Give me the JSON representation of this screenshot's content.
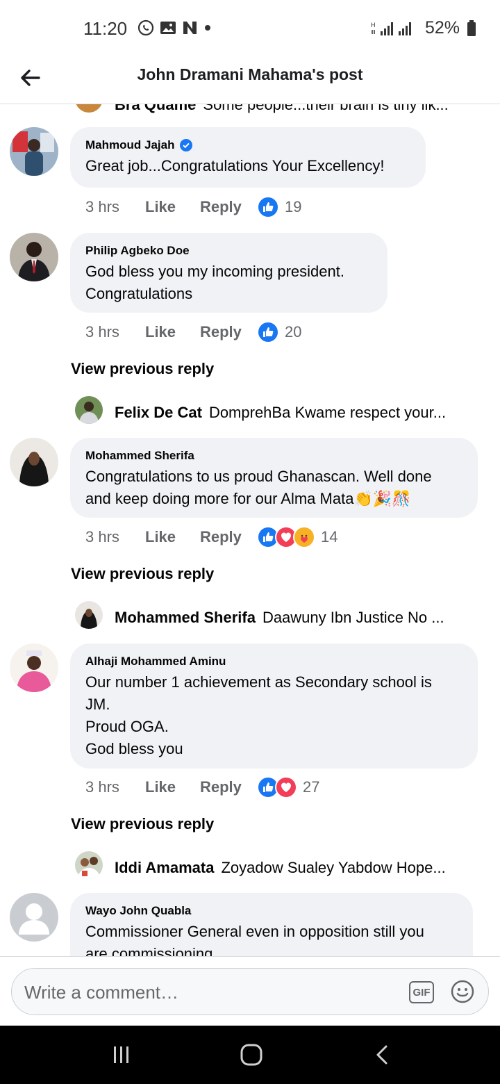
{
  "status_bar": {
    "time": "11:20",
    "battery": "52%"
  },
  "header": {
    "title": "John Dramani Mahama's post"
  },
  "top_partial": {
    "name": "Bra Quame",
    "text": "Some people...their brain is tiny lik..."
  },
  "comments": [
    {
      "name": "Mahmoud Jajah",
      "verified": true,
      "text": "Great job...Congratulations Your Excellency!",
      "time": "3 hrs",
      "like": "Like",
      "reply": "Reply",
      "reaction_count": "19"
    },
    {
      "name": "Philip Agbeko Doe",
      "text_lines": [
        "God bless you my incoming president.",
        "Congratulations"
      ],
      "time": "3 hrs",
      "like": "Like",
      "reply": "Reply",
      "reaction_count": "20",
      "view_previous": "View previous reply",
      "reply_preview": {
        "name": "Felix De Cat",
        "text": "DomprehBa Kwame respect your..."
      }
    },
    {
      "name": "Mohammed Sherifa",
      "text_lines": [
        "Congratulations to us proud Ghanascan. Well done",
        "and keep doing more for our Alma Mata👏🎉🎊"
      ],
      "time": "3 hrs",
      "like": "Like",
      "reply": "Reply",
      "reaction_count": "14",
      "view_previous": "View previous reply",
      "reply_preview": {
        "name": "Mohammed Sherifa",
        "text": "Daawuny Ibn Justice No ..."
      }
    },
    {
      "name": "Alhaji Mohammed Aminu",
      "text_lines": [
        "Our number 1 achievement as Secondary school is",
        "JM.",
        "Proud OGA.",
        "God bless you"
      ],
      "time": "3 hrs",
      "like": "Like",
      "reply": "Reply",
      "reaction_count": "27",
      "view_previous": "View previous reply",
      "reply_preview": {
        "name": "Iddi Amamata",
        "text": "Zoyadow Sualey Yabdow Hope..."
      }
    },
    {
      "name": "Wayo John Quabla",
      "text_lines": [
        "Commissioner General even in opposition still you",
        "are commissioning"
      ]
    }
  ],
  "composer": {
    "placeholder": "Write a comment…",
    "gif_label": "GIF"
  },
  "colors": {
    "like_blue": "#1877f2",
    "love_red": "#f33e58",
    "haha_yellow": "#f7b125",
    "bubble_bg": "#f0f2f5",
    "verified_blue": "#1877f2"
  },
  "icons": [
    "back-arrow-icon",
    "whatsapp-icon",
    "gallery-icon",
    "n-app-icon",
    "signal-icon",
    "battery-icon",
    "verified-icon",
    "like-reaction-icon",
    "love-reaction-icon",
    "care-reaction-icon",
    "gif-icon",
    "emoji-icon",
    "recents-icon",
    "home-icon",
    "back-nav-icon"
  ]
}
